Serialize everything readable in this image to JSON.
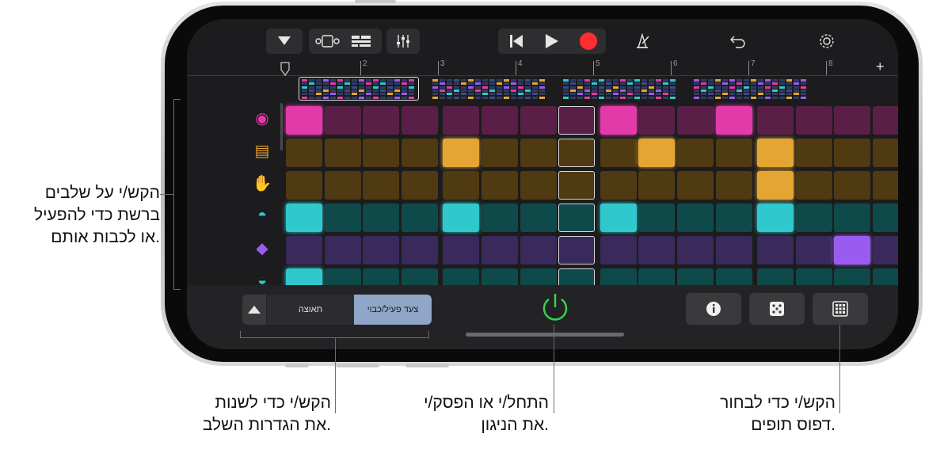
{
  "callouts": {
    "left_line1": "הקש/י על שלבים",
    "left_line2": "ברשת כדי להפעיל",
    "left_line3": "או לכבות אותם.",
    "bottom_left_line1": "הקש/י כדי לשנות",
    "bottom_left_line2": "את הגדרות השלב.",
    "bottom_mid_line1": "התחל/י או הפסק/י",
    "bottom_mid_line2": "את הניגון.",
    "bottom_right_line1": "הקש/י כדי לבחור",
    "bottom_right_line2": "דפוס תופים."
  },
  "ruler": {
    "bars": [
      "2",
      "3",
      "4",
      "5",
      "6",
      "7",
      "8"
    ],
    "plus": "+"
  },
  "bottom": {
    "tab_display": "תאוצה",
    "tab_step_toggle": "צעד פעיל/כבוי"
  },
  "colors": {
    "pink": "#e23aa8",
    "orange": "#e5a533",
    "teal": "#2fc8cc",
    "purple": "#9a5cf0",
    "record": "#ff2d2d",
    "power": "#32d74b"
  },
  "instruments": [
    {
      "icon": "kick-drum-icon",
      "color": "pink",
      "steps": [
        1,
        0,
        0,
        0,
        0,
        0,
        0,
        0,
        1,
        0,
        0,
        1,
        0,
        0,
        0,
        0
      ]
    },
    {
      "icon": "snare-drum-icon",
      "color": "orange",
      "steps": [
        0,
        0,
        0,
        0,
        1,
        0,
        0,
        0,
        0,
        1,
        0,
        0,
        1,
        0,
        0,
        0
      ]
    },
    {
      "icon": "clap-hand-icon",
      "color": "orange",
      "steps": [
        0,
        0,
        0,
        0,
        0,
        0,
        0,
        0,
        0,
        0,
        0,
        0,
        1,
        0,
        0,
        0
      ]
    },
    {
      "icon": "hi-hat-icon",
      "color": "teal",
      "steps": [
        1,
        0,
        0,
        0,
        1,
        0,
        0,
        0,
        1,
        0,
        0,
        0,
        1,
        0,
        0,
        0
      ]
    },
    {
      "icon": "tag-icon",
      "color": "purple",
      "steps": [
        0,
        0,
        0,
        0,
        0,
        0,
        0,
        0,
        0,
        0,
        0,
        0,
        0,
        0,
        1,
        0
      ]
    },
    {
      "icon": "cymbal-icon",
      "color": "teal",
      "steps": [
        1,
        0,
        0,
        0,
        0,
        0,
        0,
        0,
        0,
        0,
        0,
        0,
        0,
        0,
        0,
        0
      ]
    }
  ]
}
